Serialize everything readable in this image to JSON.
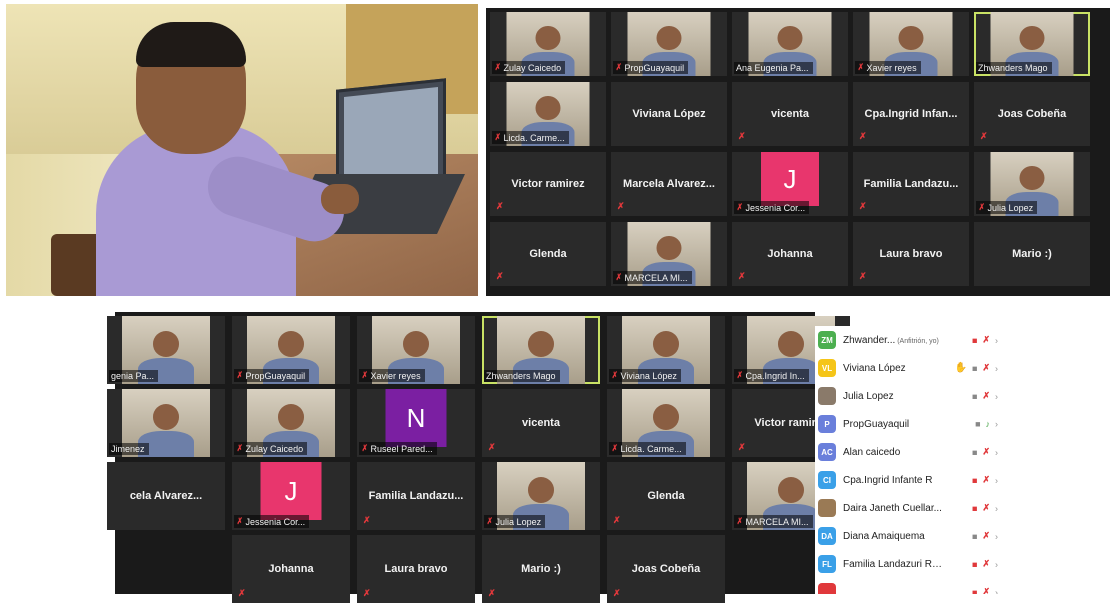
{
  "top_grid": {
    "tiles": [
      {
        "name": "Zulay Caicedo",
        "kind": "video",
        "muted": true
      },
      {
        "name": "PropGuayaquil",
        "kind": "video",
        "muted": true
      },
      {
        "name": "Ana Eugenia Pa...",
        "kind": "video",
        "muted": false
      },
      {
        "name": "Xavier reyes",
        "kind": "video",
        "muted": true
      },
      {
        "name": "Zhwanders Mago",
        "kind": "video",
        "muted": false,
        "active": true
      },
      {
        "name": "Licda. Carme...",
        "kind": "video",
        "muted": true
      },
      {
        "name": "Viviana López",
        "kind": "name",
        "muted": false
      },
      {
        "name": "vicenta",
        "kind": "name",
        "muted": true
      },
      {
        "name": "Cpa.Ingrid Infan...",
        "kind": "name",
        "muted": true
      },
      {
        "name": "Joas Cobeña",
        "kind": "name",
        "muted": true
      },
      {
        "name": "Victor ramirez",
        "kind": "name",
        "muted": true
      },
      {
        "name": "Marcela Alvarez...",
        "kind": "name",
        "muted": true
      },
      {
        "name": "Jessenia Cor...",
        "kind": "avatar",
        "letter": "J",
        "color": "#e8366d",
        "muted": true
      },
      {
        "name": "Familia Landazu...",
        "kind": "name",
        "muted": true
      },
      {
        "name": "Julia Lopez",
        "kind": "video",
        "muted": true
      },
      {
        "name": "Glenda",
        "kind": "name",
        "muted": true
      },
      {
        "name": "MARCELA MI...",
        "kind": "video",
        "muted": true
      },
      {
        "name": "Johanna",
        "kind": "name",
        "muted": true
      },
      {
        "name": "Laura bravo",
        "kind": "name",
        "muted": true
      },
      {
        "name": "Mario :)",
        "kind": "name",
        "muted": false
      }
    ]
  },
  "bottom_grid": {
    "tiles": [
      {
        "name": "genia Pa...",
        "kind": "video",
        "muted": false
      },
      {
        "name": "PropGuayaquil",
        "kind": "video",
        "muted": true
      },
      {
        "name": "Xavier reyes",
        "kind": "video",
        "muted": true
      },
      {
        "name": "Zhwanders Mago",
        "kind": "video",
        "muted": false,
        "active": true
      },
      {
        "name": "Viviana López",
        "kind": "video",
        "muted": true
      },
      {
        "name": "Cpa.Ingrid In...",
        "kind": "video",
        "muted": true
      },
      {
        "name": "Jimenez",
        "kind": "video",
        "muted": false
      },
      {
        "name": "Zulay Caicedo",
        "kind": "video",
        "muted": true
      },
      {
        "name": "Ruseel Pared...",
        "kind": "avatar",
        "letter": "N",
        "color": "#7b1fa2",
        "muted": true
      },
      {
        "name": "vicenta",
        "kind": "name",
        "muted": true
      },
      {
        "name": "Licda. Carme...",
        "kind": "video",
        "muted": true
      },
      {
        "name": "Victor ramirez",
        "kind": "name",
        "muted": true
      },
      {
        "name": "cela Alvarez...",
        "kind": "name",
        "muted": false
      },
      {
        "name": "Jessenia Cor...",
        "kind": "avatar",
        "letter": "J",
        "color": "#e8366d",
        "muted": true
      },
      {
        "name": "Familia Landazu...",
        "kind": "name",
        "muted": true
      },
      {
        "name": "Julia Lopez",
        "kind": "video",
        "muted": true
      },
      {
        "name": "Glenda",
        "kind": "name",
        "muted": true
      },
      {
        "name": "MARCELA MI...",
        "kind": "video",
        "muted": true
      },
      {
        "name": "Johanna",
        "kind": "name",
        "muted": true
      },
      {
        "name": "Laura bravo",
        "kind": "name",
        "muted": true
      },
      {
        "name": "Mario :)",
        "kind": "name",
        "muted": true
      },
      {
        "name": "Joas Cobeña",
        "kind": "name",
        "muted": true
      }
    ]
  },
  "participants": {
    "items": [
      {
        "initials": "ZM",
        "color": "#4caf50",
        "name": "Zhwander...",
        "role": "(Anfitrión, yo)",
        "cam": "off",
        "mic": "off",
        "hand": false
      },
      {
        "initials": "VL",
        "color": "#f5c518",
        "name": "Viviana López",
        "role": "",
        "cam": "on",
        "mic": "off",
        "hand": true
      },
      {
        "initials": "",
        "color": "#8a7a6a",
        "name": "Julia Lopez",
        "role": "",
        "cam": "on",
        "mic": "off",
        "hand": false
      },
      {
        "initials": "P",
        "color": "#6a7fdb",
        "name": "PropGuayaquil",
        "role": "",
        "cam": "on",
        "mic": "on",
        "hand": false
      },
      {
        "initials": "AC",
        "color": "#6a7fdb",
        "name": "Alan caicedo",
        "role": "",
        "cam": "on",
        "mic": "off",
        "hand": false
      },
      {
        "initials": "CI",
        "color": "#3aa0e8",
        "name": "Cpa.Ingrid Infante R",
        "role": "",
        "cam": "off",
        "mic": "off",
        "hand": false
      },
      {
        "initials": "",
        "color": "#9a7a55",
        "name": "Daira Janeth Cuellar...",
        "role": "",
        "cam": "off",
        "mic": "off",
        "hand": false
      },
      {
        "initials": "DA",
        "color": "#3aa0e8",
        "name": "Diana Amaiquema",
        "role": "",
        "cam": "on",
        "mic": "off",
        "hand": false
      },
      {
        "initials": "FL",
        "color": "#3aa0e8",
        "name": "Familia Landazuri Ro...",
        "role": "",
        "cam": "off",
        "mic": "off",
        "hand": false
      },
      {
        "initials": "",
        "color": "#e0383b",
        "name": "",
        "role": "",
        "cam": "off",
        "mic": "off",
        "hand": false
      }
    ]
  },
  "icons": {
    "mute": "✗",
    "camera": "■",
    "mic": "♪",
    "chevron": "›",
    "hand": "✋"
  }
}
